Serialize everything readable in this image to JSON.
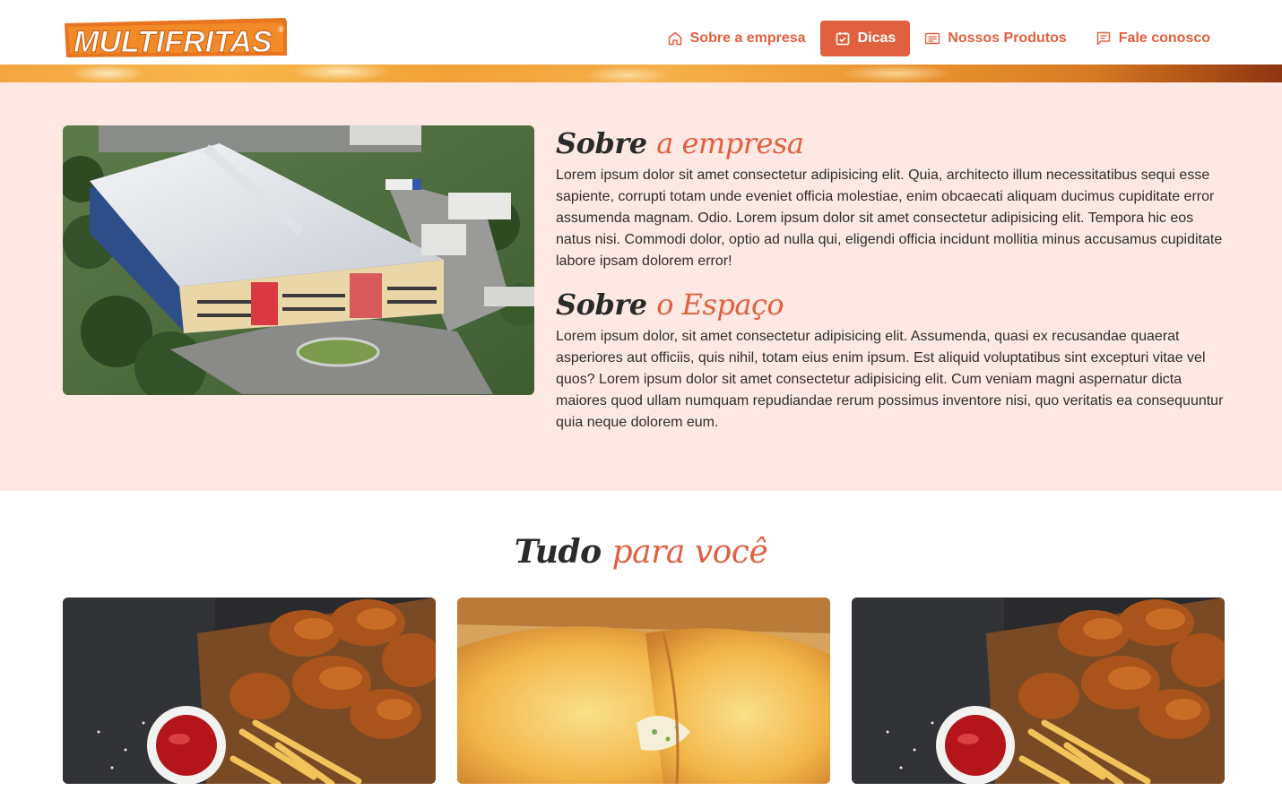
{
  "header": {
    "logo": {
      "text": "MULTIFRITAS",
      "mark": "®",
      "icon": "multifritas-logo"
    },
    "nav": [
      {
        "label": "Sobre a empresa",
        "icon": "home-icon",
        "active": false
      },
      {
        "label": "Dicas",
        "icon": "calendar-check-icon",
        "active": true
      },
      {
        "label": "Nossos Produtos",
        "icon": "list-icon",
        "active": false
      },
      {
        "label": "Fale conosco",
        "icon": "chat-icon",
        "active": false
      }
    ]
  },
  "about": {
    "image": "factory-aerial-photo",
    "empresa": {
      "title_dark": "Sobre",
      "title_accent": "a empresa",
      "text": "Lorem ipsum dolor sit amet consectetur adipisicing elit. Quia, architecto illum necessitatibus sequi esse sapiente, corrupti totam unde eveniet officia molestiae, enim obcaecati aliquam ducimus cupiditate error assumenda magnam. Odio. Lorem ipsum dolor sit amet consectetur adipisicing elit. Tempora hic eos natus nisi. Commodi dolor, optio ad nulla qui, eligendi officia incidunt mollitia minus accusamus cupiditate labore ipsam dolorem error!"
    },
    "espaco": {
      "title_dark": "Sobre",
      "title_accent": "o Espaço",
      "text": "Lorem ipsum dolor, sit amet consectetur adipisicing elit. Assumenda, quasi ex recusandae quaerat asperiores aut officiis, quis nihil, totam eius enim ipsum. Est aliquid voluptatibus sint excepturi vitae vel quos? Lorem ipsum dolor sit amet consectetur adipisicing elit. Cum veniam magni aspernatur dicta maiores quod ullam numquam repudiandae rerum possimus inventore nisi, quo veritatis ea consequuntur quia neque dolorem eum."
    }
  },
  "tudo": {
    "title_dark": "Tudo",
    "title_accent": "para você",
    "cards": [
      {
        "image": "fried-chicken-wings-photo"
      },
      {
        "image": "pastel-photo"
      },
      {
        "image": "fried-chicken-wings-photo"
      }
    ]
  },
  "colors": {
    "accent": "#e0603f",
    "about_bg": "#fde8e3",
    "text": "#2b2b2b"
  }
}
